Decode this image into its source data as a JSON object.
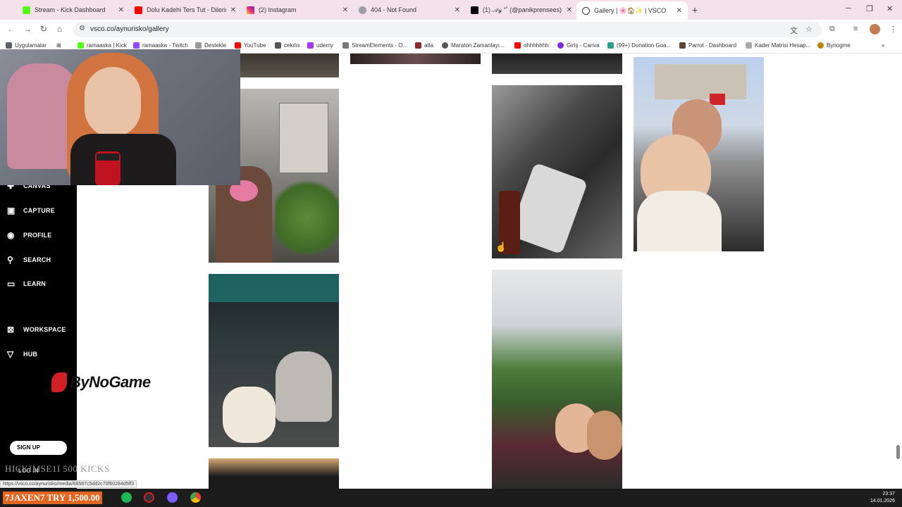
{
  "browser": {
    "tabs": [
      {
        "title": "Stream - Kick Dashboard",
        "icon": "kick-icon"
      },
      {
        "title": "Dolu Kadehi Ters Tut - Dilerim",
        "icon": "youtube-icon"
      },
      {
        "title": "(2) Instagram",
        "icon": "instagram-icon"
      },
      {
        "title": "404 - Not Found",
        "icon": "globe-icon"
      },
      {
        "title": "(1) 𝒜𝓎 ⁺˚ (@panikprensees) /",
        "icon": "x-icon"
      },
      {
        "title": "Gallery | 🌸🏠✨ | VSCO",
        "icon": "vsco-icon"
      }
    ],
    "url": "vsco.co/aynurisko/gallery",
    "bookmarks": [
      {
        "label": "Uygulamalar",
        "color": "#5f6368"
      },
      {
        "label": "ramaaska | Kick",
        "color": "#53fc18"
      },
      {
        "label": "ramaaska - Twitch",
        "color": "#9146ff"
      },
      {
        "label": "Destekle",
        "color": "#999999"
      },
      {
        "label": "YouTube",
        "color": "#ff0000"
      },
      {
        "label": "cekılıs",
        "color": "#555555"
      },
      {
        "label": "udemy",
        "color": "#a435f0"
      },
      {
        "label": "StreamElements - O...",
        "color": "#777777"
      },
      {
        "label": "atla",
        "color": "#8b2b2b"
      },
      {
        "label": "Maraton Zamanlayı...",
        "color": "#555555"
      },
      {
        "label": "ohhhhhhh",
        "color": "#ff0000"
      },
      {
        "label": "Giriş - Canva",
        "color": "#7d2ae8"
      },
      {
        "label": "(99+) Donation Goa...",
        "color": "#2a9d8f"
      },
      {
        "label": "Parrot - Dashboard",
        "color": "#5b4636"
      },
      {
        "label": "Kader Matrisi Hesap...",
        "color": "#aaaaaa"
      },
      {
        "label": "Bynogme",
        "color": "#b8860b"
      }
    ]
  },
  "sidebar": {
    "items": [
      {
        "label": "CANVAS",
        "icon": "plus-sparkle-icon"
      },
      {
        "label": "CAPTURE",
        "icon": "capture-icon"
      },
      {
        "label": "PROFILE",
        "icon": "profile-icon"
      },
      {
        "label": "SEARCH",
        "icon": "search-icon"
      },
      {
        "label": "LEARN",
        "icon": "book-icon"
      },
      {
        "label": "WORKSPACE",
        "icon": "workspace-icon"
      },
      {
        "label": "HUB",
        "icon": "hub-icon"
      }
    ],
    "signup_label": "SIGN UP",
    "login_label": "LOG IN"
  },
  "overlay": {
    "brand": "ByNoGame",
    "kicks_text": "HICKIMSE1I  500  KICKS",
    "donation": "7JAXEN7  TRY 1,500.00",
    "status_url": "https://vsco.co/aynurisko/media/68587c5dd2c70f60284d5ff3"
  },
  "system": {
    "time": "23:37",
    "date": "14.01.2026"
  },
  "colors": {
    "tabstrip": "#f5e1ea",
    "sidebar": "#000000",
    "donation_bg": "#e2661f"
  }
}
